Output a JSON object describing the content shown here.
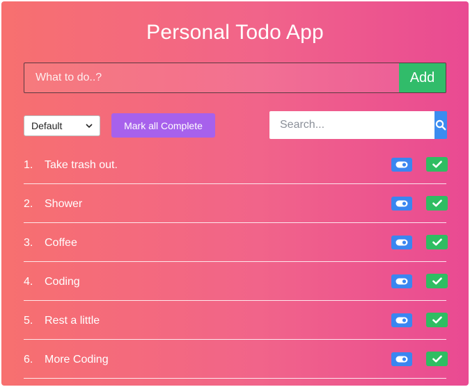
{
  "app": {
    "title": "Personal Todo App"
  },
  "add_form": {
    "placeholder": "What to do..?",
    "button_label": "Add"
  },
  "toolbar": {
    "filter_selected": "Default",
    "mark_all_label": "Mark all Complete",
    "search_placeholder": "Search..."
  },
  "todos": [
    {
      "num": "1.",
      "label": "Take trash out."
    },
    {
      "num": "2.",
      "label": "Shower"
    },
    {
      "num": "3.",
      "label": "Coffee"
    },
    {
      "num": "4.",
      "label": "Coding"
    },
    {
      "num": "5.",
      "label": "Rest a little"
    },
    {
      "num": "6.",
      "label": "More Coding"
    }
  ],
  "icons": {
    "search": "search-icon",
    "toggle": "toggle-icon",
    "check": "check-icon",
    "dropdown": "chevron-down-icon"
  },
  "colors": {
    "gradient_start": "#f7706f",
    "gradient_end": "#e94a92",
    "add_button": "#31bc6a",
    "mark_all_button": "#a761ec",
    "search_button": "#3b8cf0",
    "toggle_button": "#3a86f0",
    "complete_button": "#2fbd62"
  }
}
